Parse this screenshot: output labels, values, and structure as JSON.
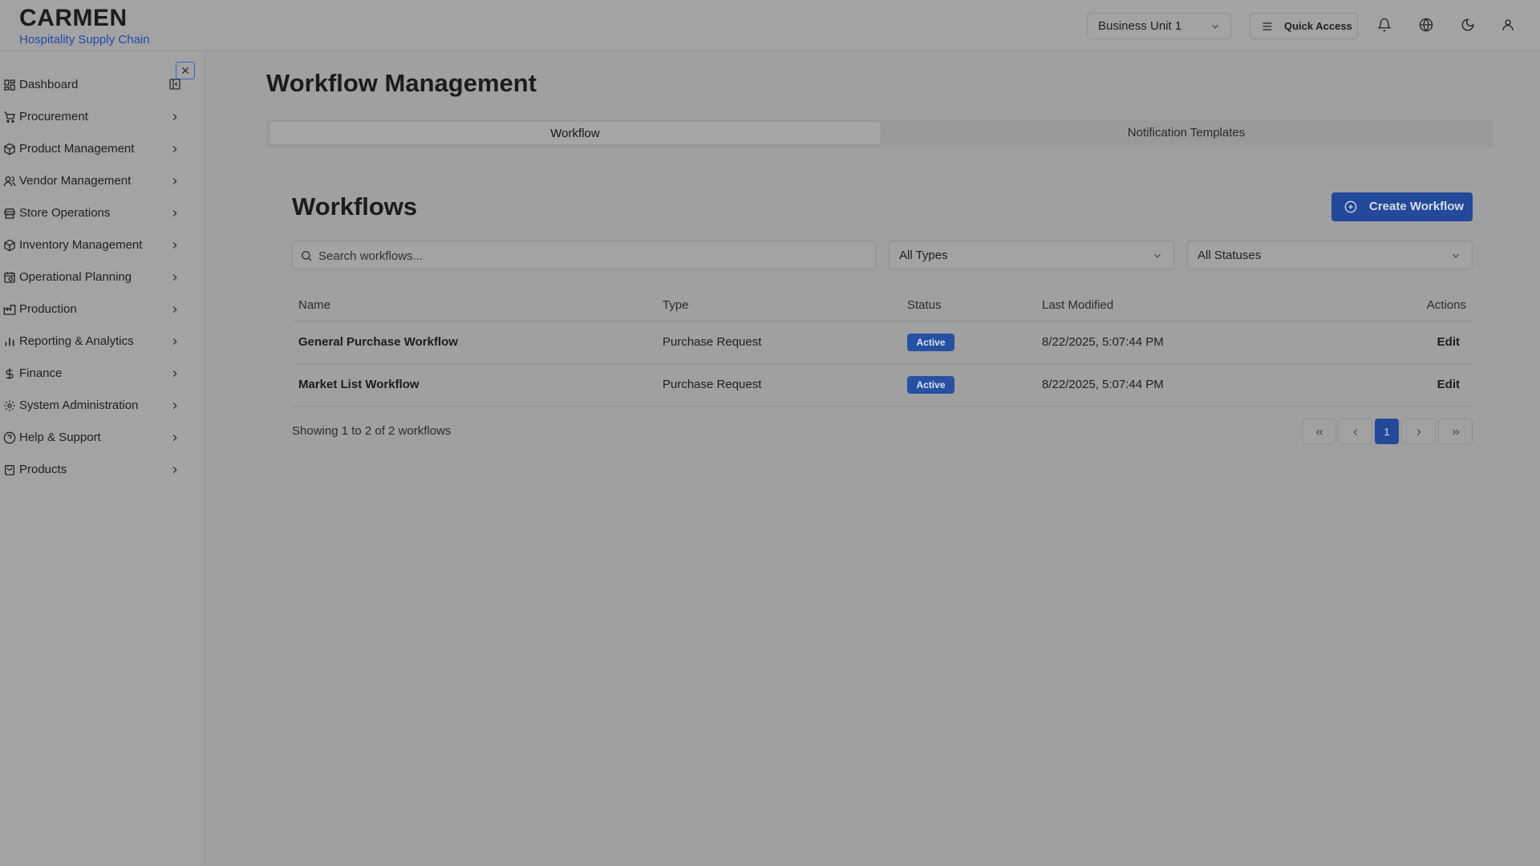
{
  "brand": {
    "title": "CARMEN",
    "subtitle": "Hospitality Supply Chain"
  },
  "header": {
    "business_unit": "Business Unit 1",
    "quick_access": "Quick Access",
    "icons": [
      "bell-icon",
      "globe-icon",
      "moon-icon",
      "user-icon"
    ]
  },
  "sidebar": {
    "items": [
      {
        "label": "Dashboard",
        "icon": "dashboard-icon"
      },
      {
        "label": "Procurement",
        "icon": "cart-icon"
      },
      {
        "label": "Product Management",
        "icon": "package-icon"
      },
      {
        "label": "Vendor Management",
        "icon": "users-icon"
      },
      {
        "label": "Store Operations",
        "icon": "store-icon"
      },
      {
        "label": "Inventory Management",
        "icon": "box-icon"
      },
      {
        "label": "Operational Planning",
        "icon": "calendar-icon"
      },
      {
        "label": "Production",
        "icon": "factory-icon"
      },
      {
        "label": "Reporting & Analytics",
        "icon": "bar-chart-icon"
      },
      {
        "label": "Finance",
        "icon": "dollar-icon"
      },
      {
        "label": "System Administration",
        "icon": "gear-icon"
      },
      {
        "label": "Help & Support",
        "icon": "help-icon"
      },
      {
        "label": "Products",
        "icon": "bag-icon"
      }
    ]
  },
  "main": {
    "title": "Workflow Management",
    "tabs": [
      {
        "label": "Workflow",
        "active": true
      },
      {
        "label": "Notification Templates",
        "active": false
      }
    ],
    "section_title": "Workflows",
    "create_button": "Create Workflow",
    "search_placeholder": "Search workflows...",
    "filters": {
      "type": "All Types",
      "status": "All Statuses"
    },
    "table": {
      "headers": [
        "Name",
        "Type",
        "Status",
        "Last Modified",
        "Actions"
      ],
      "rows": [
        {
          "name": "General Purchase Workflow",
          "type": "Purchase Request",
          "status": "Active",
          "modified": "8/22/2025, 5:07:44 PM",
          "action": "Edit"
        },
        {
          "name": "Market List Workflow",
          "type": "Purchase Request",
          "status": "Active",
          "modified": "8/22/2025, 5:07:44 PM",
          "action": "Edit"
        }
      ]
    },
    "pagination": {
      "summary": "Showing 1 to 2 of 2 workflows",
      "current_page": "1"
    }
  },
  "colors": {
    "accent": "#23499a",
    "brand_subtitle": "#1e4aa3",
    "overlay_bg": "#a0a0a0"
  }
}
